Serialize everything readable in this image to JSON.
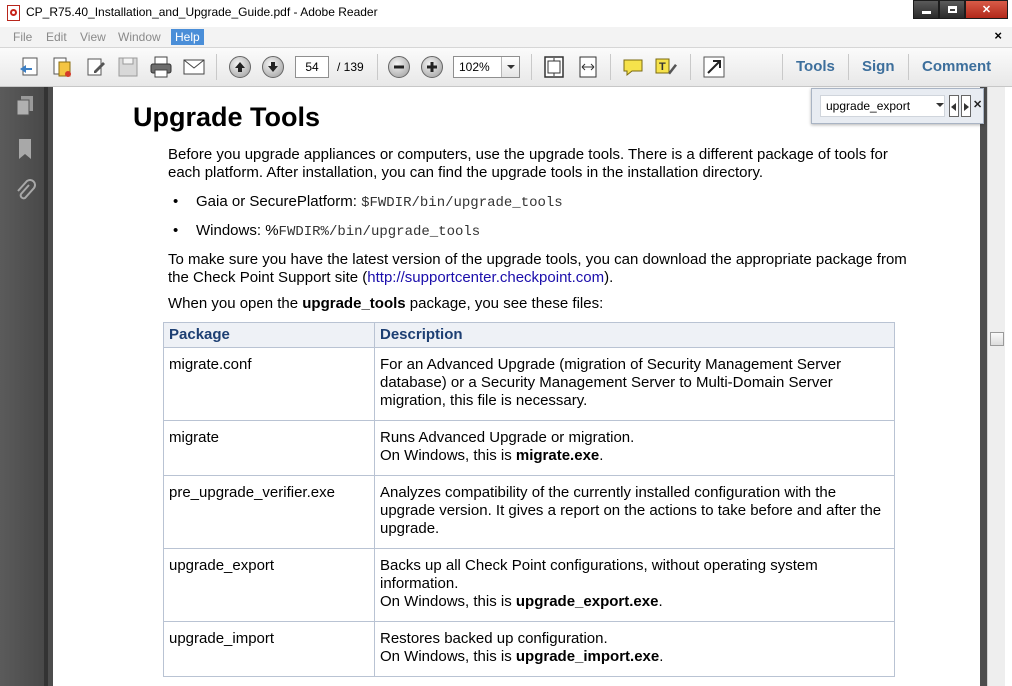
{
  "window": {
    "title": "CP_R75.40_Installation_and_Upgrade_Guide.pdf - Adobe Reader"
  },
  "menu": {
    "items": [
      "File",
      "Edit",
      "View",
      "Window",
      "Help"
    ],
    "active": "Help"
  },
  "toolbar": {
    "page_current": "54",
    "page_total": "/ 139",
    "zoom": "102%",
    "tools_label": "Tools",
    "sign_label": "Sign",
    "comment_label": "Comment"
  },
  "find": {
    "query": "upgrade_export"
  },
  "document": {
    "heading": "Upgrade Tools",
    "intro": "Before you upgrade appliances or computers, use the upgrade tools. There is a different package of tools for each platform. After installation, you can find the upgrade tools in the installation directory.",
    "bullets": [
      {
        "label": "Gaia or SecurePlatform:",
        "code": "$FWDIR/bin/upgrade_tools"
      },
      {
        "label": "Windows:",
        "prefix": "%",
        "code": "FWDIR%/bin/upgrade_tools"
      }
    ],
    "latest_text": "To make sure you have the latest version of the upgrade tools, you can download the appropriate package from the Check Point Support site (",
    "latest_link": "http://supportcenter.checkpoint.com",
    "latest_end": ").",
    "open_pre": "When you open the ",
    "open_bold": "upgrade_tools",
    "open_post": " package, you see these files:",
    "table": {
      "headers": [
        "Package",
        "Description"
      ],
      "rows": [
        {
          "package": "migrate.conf",
          "desc": "For an Advanced Upgrade (migration of Security Management Server database) or a Security Management Server to Multi-Domain Server migration, this file is necessary.",
          "win_pre": "",
          "win_bold": "",
          "win_post": ""
        },
        {
          "package": "migrate",
          "desc": "Runs Advanced Upgrade or migration.",
          "win_pre": "On Windows, this is ",
          "win_bold": "migrate.exe",
          "win_post": "."
        },
        {
          "package": "pre_upgrade_verifier.exe",
          "desc": "Analyzes compatibility of the currently installed configuration with the upgrade version. It gives a report on the actions to take before and after the upgrade.",
          "win_pre": "",
          "win_bold": "",
          "win_post": ""
        },
        {
          "package": "upgrade_export",
          "desc": "Backs up all Check Point configurations, without operating system information.",
          "win_pre": "On Windows, this is ",
          "win_bold": "upgrade_export.exe",
          "win_post": "."
        },
        {
          "package": "upgrade_import",
          "desc": "Restores backed up configuration.",
          "win_pre": "On Windows, this is ",
          "win_bold": "upgrade_import.exe",
          "win_post": "."
        }
      ]
    }
  }
}
